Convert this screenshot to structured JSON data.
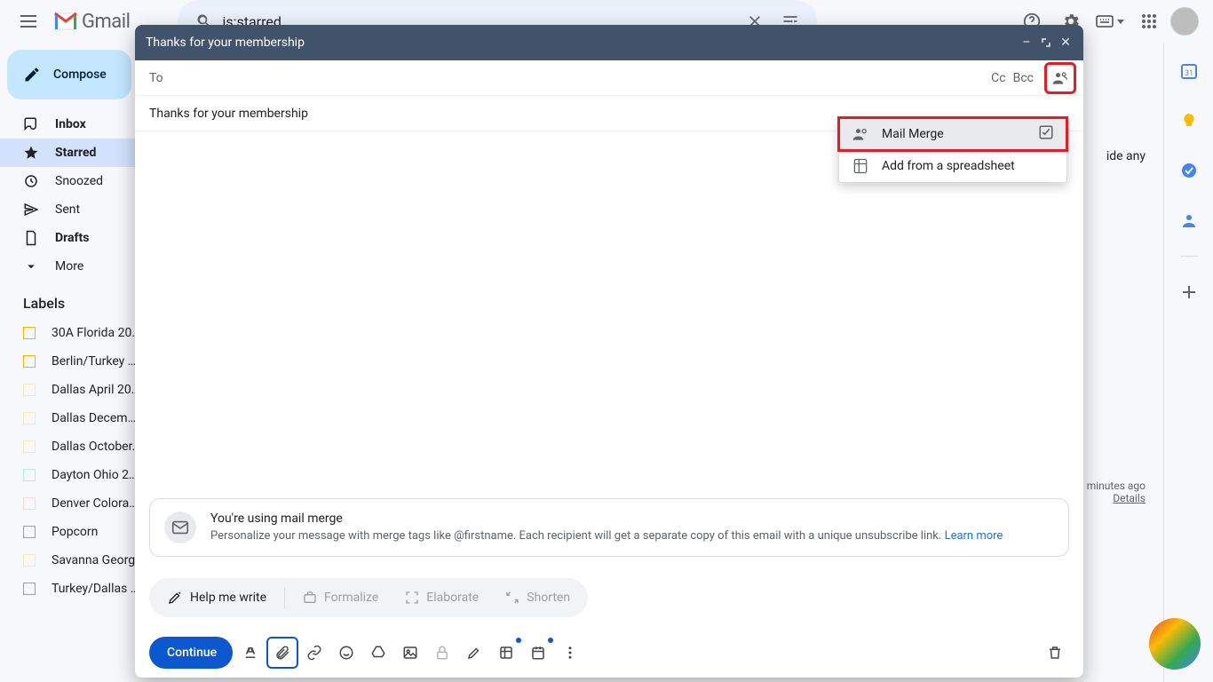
{
  "app": {
    "name": "Gmail"
  },
  "search": {
    "value": "is:starred"
  },
  "sidebar": {
    "compose": "Compose",
    "nav": [
      {
        "id": "inbox",
        "label": "Inbox",
        "bold": true
      },
      {
        "id": "starred",
        "label": "Starred",
        "active": true
      },
      {
        "id": "snoozed",
        "label": "Snoozed"
      },
      {
        "id": "sent",
        "label": "Sent"
      },
      {
        "id": "drafts",
        "label": "Drafts",
        "bold": true
      },
      {
        "id": "more",
        "label": "More"
      }
    ],
    "labels_title": "Labels",
    "labels": [
      "30A Florida 20…",
      "Berlin/Turkey …",
      "Dallas April 20…",
      "Dallas Decem…",
      "Dallas October…",
      "Dayton Ohio 2…",
      "Denver Colora…",
      "Popcorn",
      "Savanna Georg…",
      "Turkey/Dallas …"
    ]
  },
  "main": {
    "empty_hint": "ide any",
    "footer_activity": "minutes ago",
    "footer_details": "Details"
  },
  "compose_window": {
    "title": "Thanks for your membership",
    "to_label": "To",
    "cc": "Cc",
    "bcc": "Bcc",
    "subject": "Thanks for your membership",
    "dropdown": {
      "mail_merge": "Mail Merge",
      "add_spreadsheet": "Add from a spreadsheet"
    },
    "merge_banner": {
      "title": "You're using mail merge",
      "body_1": "Personalize your message with merge tags like @firstname. Each recipient will get a separate copy of this email with a unique unsubscribe link.",
      "learn_more": "Learn more"
    },
    "suggestions": {
      "help": "Help me write",
      "formalize": "Formalize",
      "elaborate": "Elaborate",
      "shorten": "Shorten"
    },
    "send": "Continue"
  },
  "colors": {
    "accent": "#0b57d0",
    "highlight_red": "#e51c23"
  }
}
